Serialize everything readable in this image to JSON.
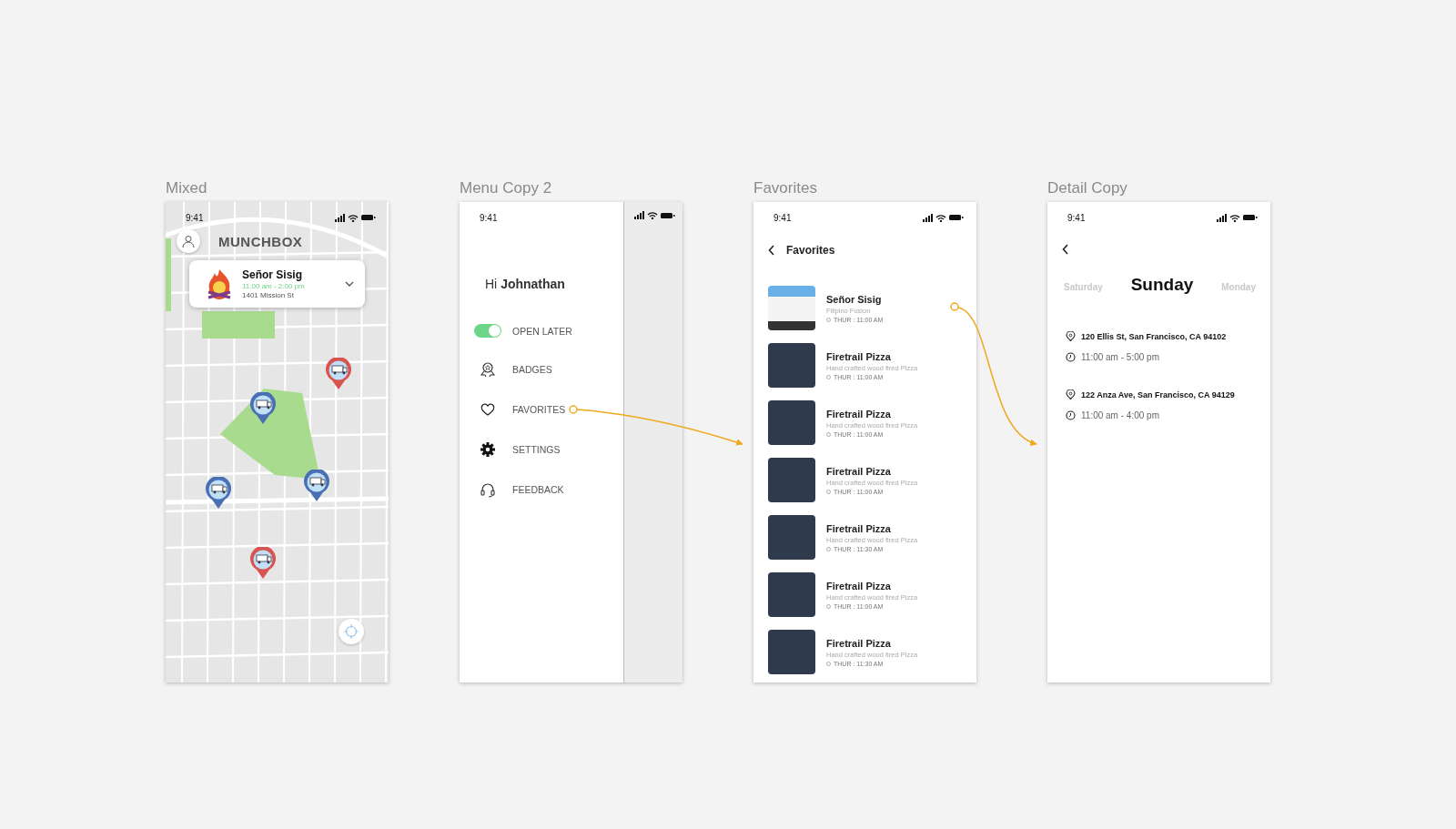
{
  "screens": [
    {
      "kind": "map",
      "label": "Mixed",
      "time": "9:41",
      "app_title": "MUNCHBOX",
      "card": {
        "name": "Señor Sisig",
        "hours": "11:00 am - 2:00 pm",
        "address": "1401 Mission St"
      },
      "pins": [
        {
          "color": "#d9534f"
        },
        {
          "color": "#4a6fb5"
        },
        {
          "color": "#4a6fb5"
        },
        {
          "color": "#4a6fb5"
        },
        {
          "color": "#d9534f"
        }
      ]
    },
    {
      "kind": "menu",
      "label": "Menu Copy 2",
      "time": "9:41",
      "greeting": "Hi",
      "user": "Johnathan",
      "items": [
        {
          "kind": "toggle",
          "label": "OPEN LATER",
          "on": true
        },
        {
          "kind": "badge",
          "label": "BADGES"
        },
        {
          "kind": "heart",
          "label": "FAVORITES"
        },
        {
          "kind": "gear",
          "label": "SETTINGS"
        },
        {
          "kind": "headset",
          "label": "FEEDBACK"
        }
      ]
    },
    {
      "kind": "list",
      "label": "Favorites",
      "time": "9:41",
      "title": "Favorites",
      "rows": [
        {
          "name": "Señor Sisig",
          "subtitle": "Filipino Fusion",
          "time": "THUR : 11:00 AM"
        },
        {
          "name": "Firetrail Pizza",
          "subtitle": "Hand crafted wood fired Pizza",
          "time": "THUR : 11:00 AM"
        },
        {
          "name": "Firetrail Pizza",
          "subtitle": "Hand crafted wood fired Pizza",
          "time": "THUR : 11:00 AM"
        },
        {
          "name": "Firetrail Pizza",
          "subtitle": "Hand crafted wood fired Pizza",
          "time": "THUR : 11:00 AM"
        },
        {
          "name": "Firetrail Pizza",
          "subtitle": "Hand crafted wood fired Pizza",
          "time": "THUR : 11:30 AM"
        },
        {
          "name": "Firetrail Pizza",
          "subtitle": "Hand crafted wood fired Pizza",
          "time": "THUR : 11:00 AM"
        },
        {
          "name": "Firetrail Pizza",
          "subtitle": "Hand crafted wood fired Pizza",
          "time": "THUR : 11:30 AM"
        }
      ]
    },
    {
      "kind": "detail",
      "label": "Detail Copy",
      "time": "9:41",
      "days": [
        {
          "label": "Saturday",
          "selected": false
        },
        {
          "label": "Sunday",
          "selected": true
        },
        {
          "label": "Monday",
          "selected": false
        }
      ],
      "stops": [
        {
          "address": "120 Ellis St, San Francisco, CA 94102",
          "hours": "11:00 am - 5:00 pm"
        },
        {
          "address": "122 Anza Ave, San Francisco, CA 94129",
          "hours": "11:00 am - 4:00 pm"
        }
      ]
    }
  ]
}
